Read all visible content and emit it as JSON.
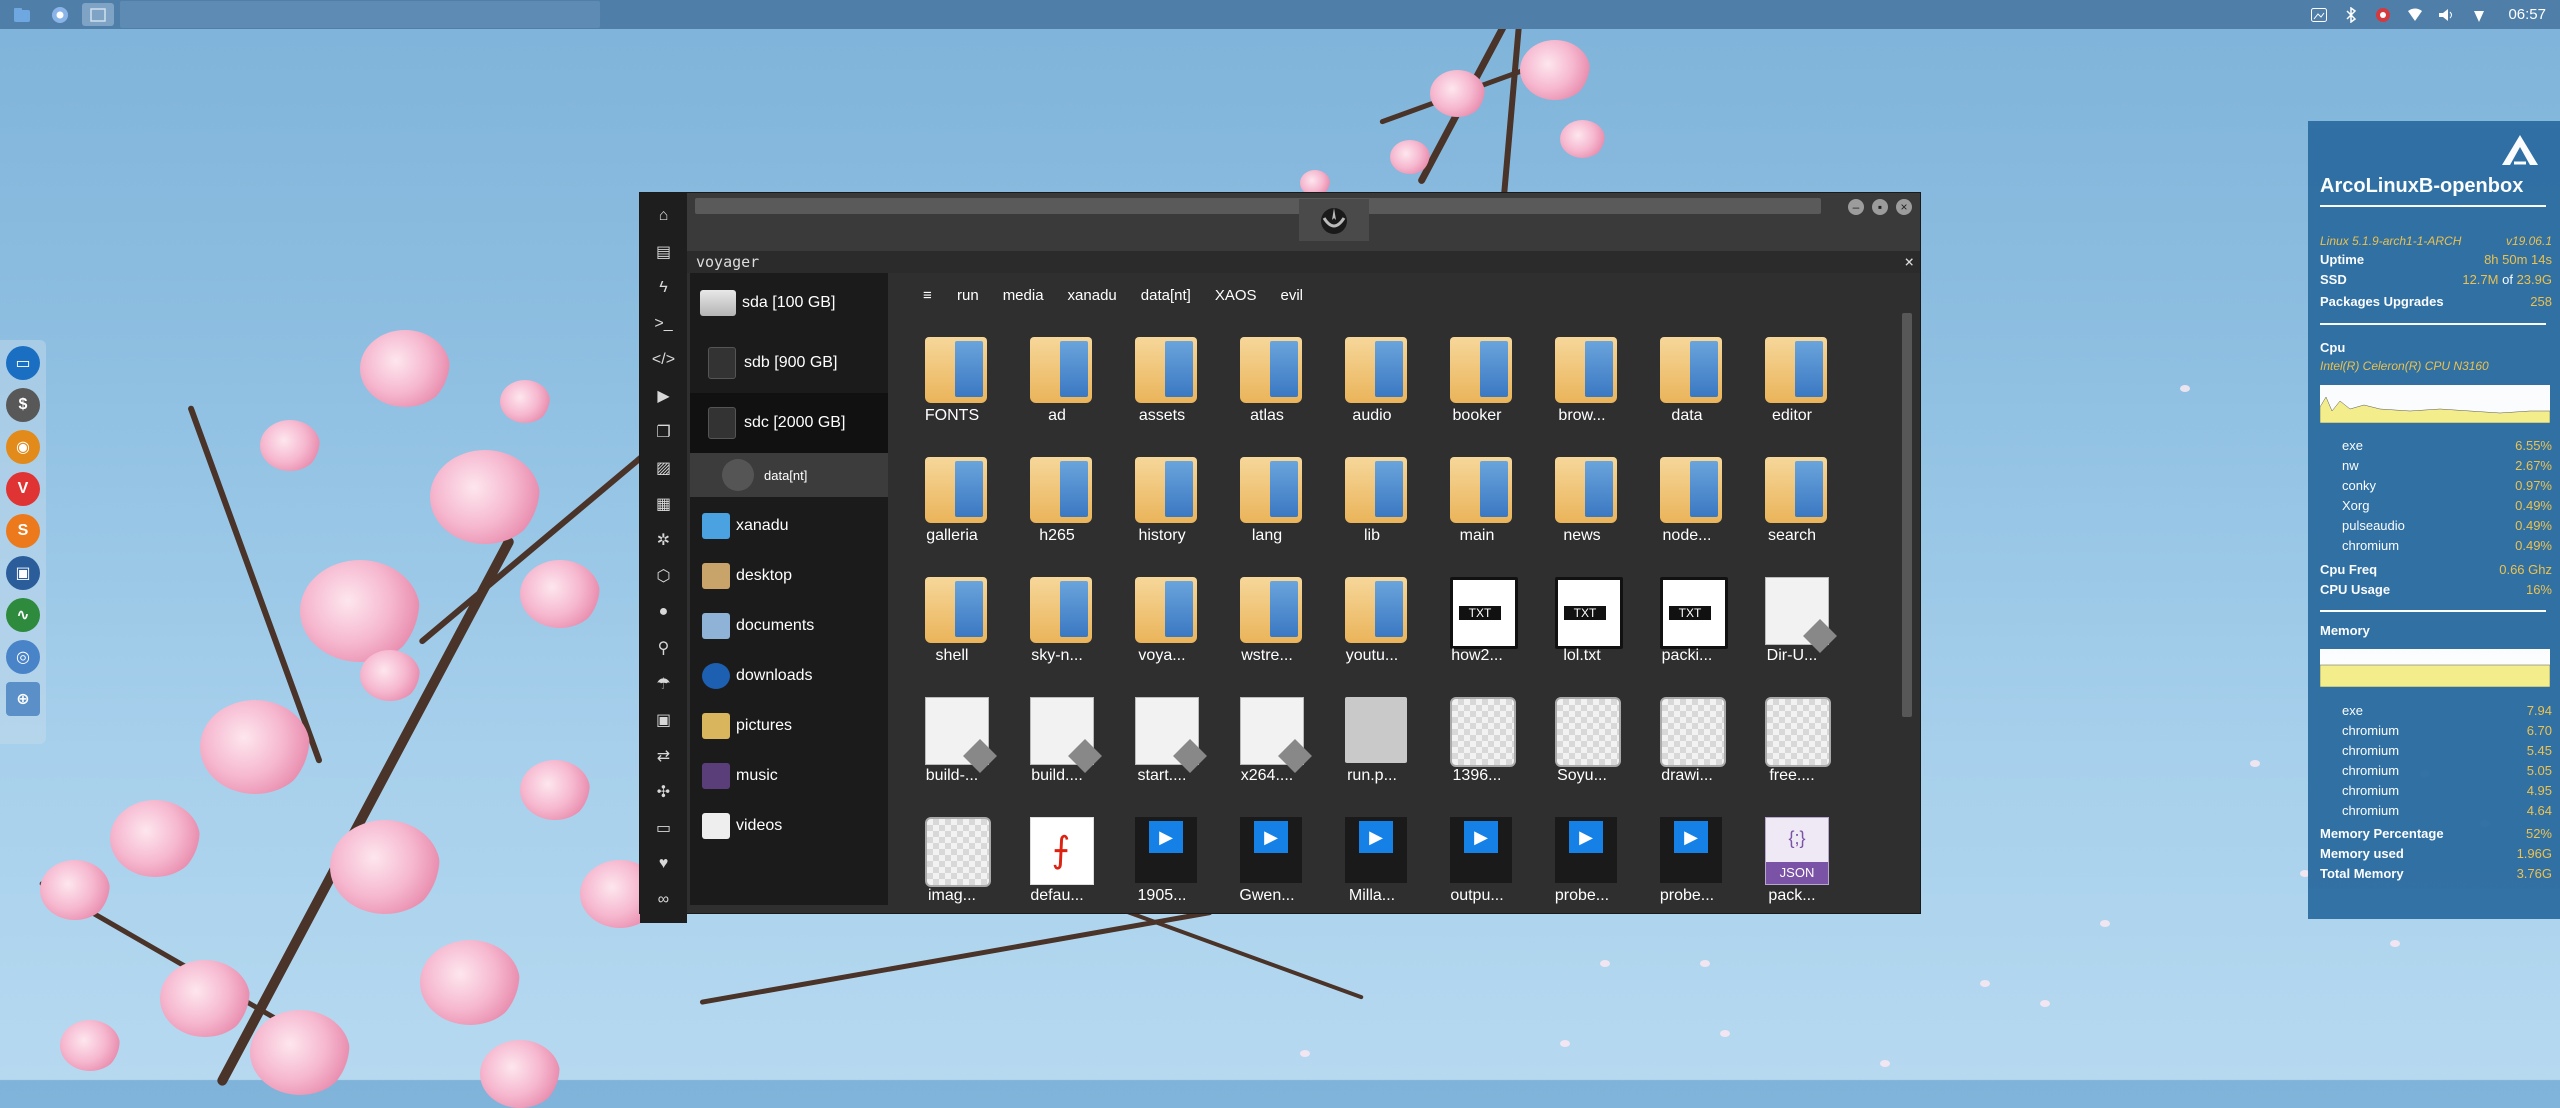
{
  "top_panel": {
    "clock": "06:57",
    "launchers": [
      "files-icon",
      "chromium-icon",
      "taskbar-window"
    ]
  },
  "dock": {
    "items": [
      "file-manager-icon",
      "dollar-icon",
      "vlc-icon",
      "vivaldi-icon",
      "s-icon",
      "screenshot-icon",
      "activity-monitor-icon",
      "chrome-icon",
      "globe-icon"
    ]
  },
  "file_manager": {
    "title": "voyager",
    "sidebar": {
      "drives": [
        {
          "label": "sda [100 GB]",
          "active": false
        },
        {
          "label": "sdb [900 GB]",
          "active": false
        },
        {
          "label": "sdc [2000 GB]",
          "active": true
        }
      ],
      "mounted": "data[nt]",
      "places": [
        "xanadu",
        "desktop",
        "documents",
        "downloads",
        "pictures",
        "music",
        "videos"
      ]
    },
    "breadcrumbs": [
      "run",
      "media",
      "xanadu",
      "data[nt]",
      "XAOS",
      "evil"
    ],
    "files": [
      {
        "name": "FONTS",
        "type": "folder"
      },
      {
        "name": "ad",
        "type": "folder"
      },
      {
        "name": "assets",
        "type": "folder"
      },
      {
        "name": "atlas",
        "type": "folder"
      },
      {
        "name": "audio",
        "type": "folder"
      },
      {
        "name": "booker",
        "type": "folder"
      },
      {
        "name": "brow...",
        "type": "folder"
      },
      {
        "name": "data",
        "type": "folder"
      },
      {
        "name": "editor",
        "type": "folder"
      },
      {
        "name": "galleria",
        "type": "folder"
      },
      {
        "name": "h265",
        "type": "folder"
      },
      {
        "name": "history",
        "type": "folder"
      },
      {
        "name": "lang",
        "type": "folder"
      },
      {
        "name": "lib",
        "type": "folder"
      },
      {
        "name": "main",
        "type": "folder"
      },
      {
        "name": "news",
        "type": "folder"
      },
      {
        "name": "node...",
        "type": "folder"
      },
      {
        "name": "search",
        "type": "folder"
      },
      {
        "name": "shell",
        "type": "folder"
      },
      {
        "name": "sky-n...",
        "type": "folder"
      },
      {
        "name": "voya...",
        "type": "folder"
      },
      {
        "name": "wstre...",
        "type": "folder"
      },
      {
        "name": "youtu...",
        "type": "folder"
      },
      {
        "name": "how2...",
        "type": "txt"
      },
      {
        "name": "lol.txt",
        "type": "txt"
      },
      {
        "name": "packi...",
        "type": "txt"
      },
      {
        "name": "Dir-U...",
        "type": "generic"
      },
      {
        "name": "build-...",
        "type": "generic"
      },
      {
        "name": "build....",
        "type": "generic"
      },
      {
        "name": "start....",
        "type": "generic"
      },
      {
        "name": "x264....",
        "type": "generic"
      },
      {
        "name": "run.p...",
        "type": "blank"
      },
      {
        "name": "1396...",
        "type": "image"
      },
      {
        "name": "Soyu...",
        "type": "image"
      },
      {
        "name": "drawi...",
        "type": "image"
      },
      {
        "name": "free....",
        "type": "image"
      },
      {
        "name": "imag...",
        "type": "image"
      },
      {
        "name": "defau...",
        "type": "pdf"
      },
      {
        "name": "1905...",
        "type": "video"
      },
      {
        "name": "Gwen...",
        "type": "video"
      },
      {
        "name": "Milla...",
        "type": "video"
      },
      {
        "name": "outpu...",
        "type": "video"
      },
      {
        "name": "probe...",
        "type": "video"
      },
      {
        "name": "probe...",
        "type": "video"
      },
      {
        "name": "pack...",
        "type": "json"
      }
    ],
    "txt_badge": "TXT",
    "json_badge": "JSON",
    "json_braces": "{;}"
  },
  "conky": {
    "hostname": "ArcoLinuxB-openbox",
    "kernel": "Linux 5.1.9-arch1-1-ARCH",
    "version": "v19.06.1",
    "uptime_label": "Uptime",
    "uptime": "8h 50m 14s",
    "ssd_label": "SSD",
    "ssd_used": "12.7M",
    "ssd_of": "of",
    "ssd_total": "23.9G",
    "pkg_label": "Packages Upgrades",
    "pkg": "258",
    "cpu_label": "Cpu",
    "cpu_model": "Intel(R) Celeron(R) CPU  N3160",
    "cpu_procs": [
      {
        "name": "exe",
        "value": "6.55%"
      },
      {
        "name": "nw",
        "value": "2.67%"
      },
      {
        "name": "conky",
        "value": "0.97%"
      },
      {
        "name": "Xorg",
        "value": "0.49%"
      },
      {
        "name": "pulseaudio",
        "value": "0.49%"
      },
      {
        "name": "chromium",
        "value": "0.49%"
      }
    ],
    "cpu_freq_label": "Cpu Freq",
    "cpu_freq": "0.66 Ghz",
    "cpu_usage_label": "CPU Usage",
    "cpu_usage": "16%",
    "mem_label": "Memory",
    "mem_procs": [
      {
        "name": "exe",
        "value": "7.94"
      },
      {
        "name": "chromium",
        "value": "6.70"
      },
      {
        "name": "chromium",
        "value": "5.45"
      },
      {
        "name": "chromium",
        "value": "5.05"
      },
      {
        "name": "chromium",
        "value": "4.95"
      },
      {
        "name": "chromium",
        "value": "4.64"
      }
    ],
    "mem_pct_label": "Memory Percentage",
    "mem_pct": "52%",
    "mem_used_label": "Memory used",
    "mem_used": "1.96G",
    "mem_total_label": "Total Memory",
    "mem_total": "3.76G",
    "accent": "#f0c24a",
    "graph_fill": "#f7ef88"
  }
}
